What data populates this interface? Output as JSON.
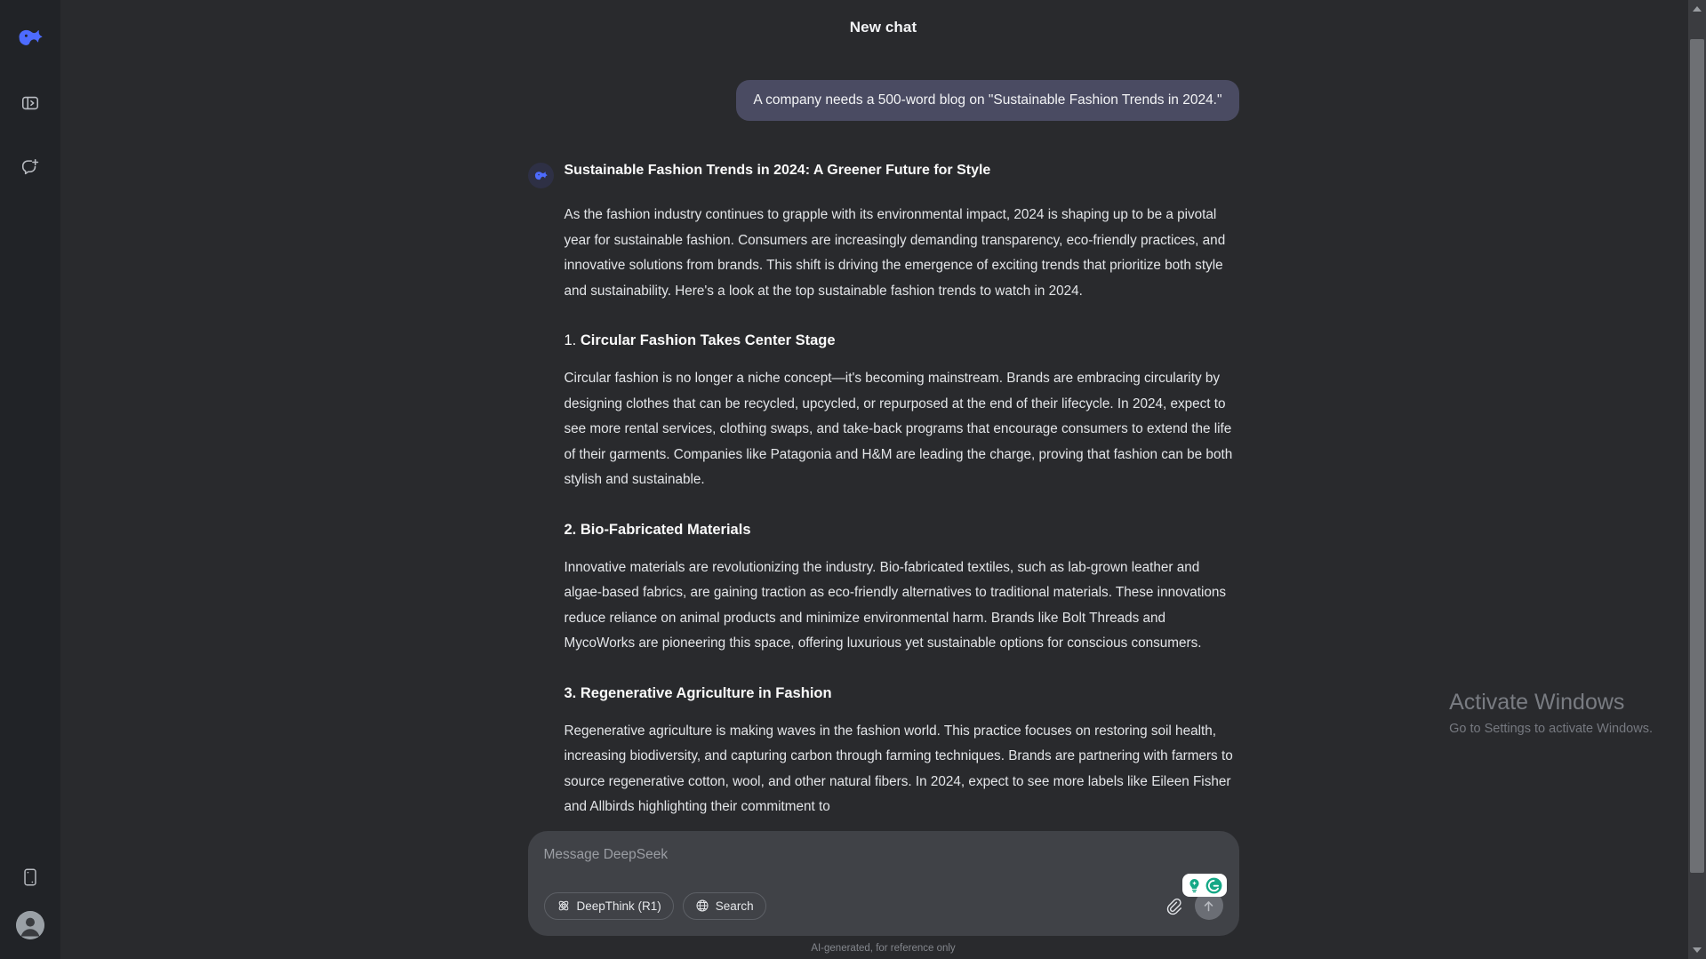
{
  "sidebar": {
    "logo_icon": "deepseek-whale-logo",
    "items": [
      {
        "icon": "panel-toggle-icon",
        "name": "toggle-sidebar"
      },
      {
        "icon": "new-chat-icon",
        "name": "new-chat"
      }
    ],
    "bottom_items": [
      {
        "icon": "mobile-app-icon",
        "name": "get-app"
      },
      {
        "icon": "user-avatar-icon",
        "name": "profile"
      }
    ]
  },
  "header": {
    "title": "New chat"
  },
  "conversation": {
    "user_message": "A company needs a 500-word blog on \"Sustainable Fashion Trends in 2024.\"",
    "assistant": {
      "avatar_icon": "deepseek-whale-logo",
      "title": "Sustainable Fashion Trends in 2024: A Greener Future for Style",
      "intro": "As the fashion industry continues to grapple with its environmental impact, 2024 is shaping up to be a pivotal year for sustainable fashion. Consumers are increasingly demanding transparency, eco-friendly practices, and innovative solutions from brands. This shift is driving the emergence of exciting trends that prioritize both style and sustainability. Here's a look at the top sustainable fashion trends to watch in 2024.",
      "sections": [
        {
          "number": "1.",
          "heading": "Circular Fashion Takes Center Stage",
          "body": "Circular fashion is no longer a niche concept—it's becoming mainstream. Brands are embracing circularity by designing clothes that can be recycled, upcycled, or repurposed at the end of their lifecycle. In 2024, expect to see more rental services, clothing swaps, and take-back programs that encourage consumers to extend the life of their garments. Companies like Patagonia and H&M are leading the charge, proving that fashion can be both stylish and sustainable."
        },
        {
          "number": "2.",
          "heading": "Bio-Fabricated Materials",
          "body": "Innovative materials are revolutionizing the industry. Bio-fabricated textiles, such as lab-grown leather and algae-based fabrics, are gaining traction as eco-friendly alternatives to traditional materials. These innovations reduce reliance on animal products and minimize environmental harm. Brands like Bolt Threads and MycoWorks are pioneering this space, offering luxurious yet sustainable options for conscious consumers."
        },
        {
          "number": "3.",
          "heading": "Regenerative Agriculture in Fashion",
          "body": "Regenerative agriculture is making waves in the fashion world. This practice focuses on restoring soil health, increasing biodiversity, and capturing carbon through farming techniques. Brands are partnering with farmers to source regenerative cotton, wool, and other natural fibers. In 2024, expect to see more labels like Eileen Fisher and Allbirds highlighting their commitment to"
        }
      ]
    },
    "scroll_down_icon": "chevron-down-icon"
  },
  "composer": {
    "placeholder": "Message DeepSeek",
    "value": "",
    "pills": [
      {
        "label": "DeepThink (R1)",
        "icon": "atom-icon"
      },
      {
        "label": "Search",
        "icon": "globe-icon"
      }
    ],
    "attach_icon": "paperclip-icon",
    "send_icon": "arrow-up-icon",
    "grammarly": {
      "name": "grammarly-badge",
      "letter": "G"
    },
    "footnote": "AI-generated, for reference only"
  },
  "watermark": {
    "title": "Activate Windows",
    "subtitle": "Go to Settings to activate Windows."
  },
  "scrollbar": {
    "up_icon": "scroll-up-arrow",
    "down_icon": "scroll-down-arrow"
  },
  "colors": {
    "app_bg": "#292a2d",
    "sidebar_bg": "#212327",
    "user_bubble": "#4a4b62",
    "composer_bg": "#404247",
    "accent_blue": "#4d6bfe",
    "grammarly_green": "#15a886"
  }
}
